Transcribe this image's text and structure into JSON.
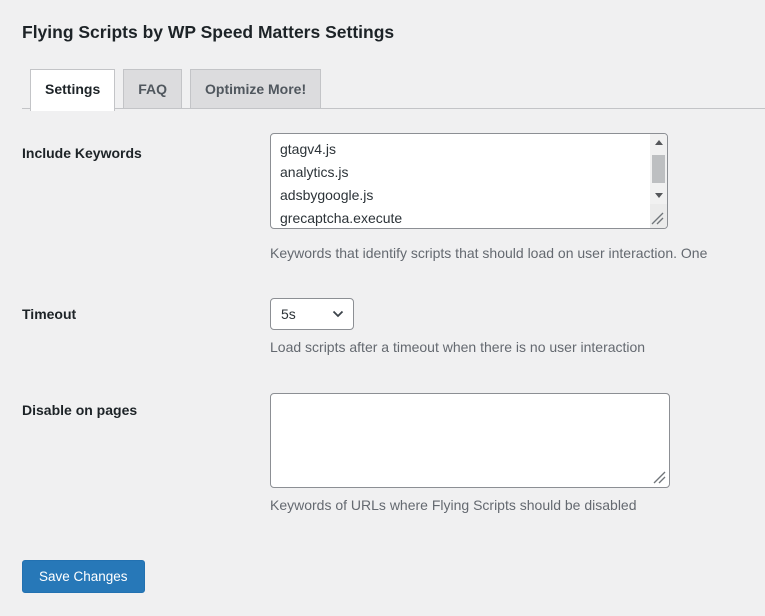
{
  "header": {
    "title": "Flying Scripts by WP Speed Matters Settings"
  },
  "tabs": {
    "items": [
      {
        "label": "Settings",
        "active": true
      },
      {
        "label": "FAQ",
        "active": false
      },
      {
        "label": "Optimize More!",
        "active": false
      }
    ]
  },
  "form": {
    "include_keywords": {
      "label": "Include Keywords",
      "lines": [
        "gtagv4.js",
        "analytics.js",
        "adsbygoogle.js",
        "grecaptcha.execute"
      ],
      "value": "gtagv4.js\nanalytics.js\nadsbygoogle.js\ngrecaptcha.execute",
      "help": "Keywords that identify scripts that should load on user interaction. One"
    },
    "timeout": {
      "label": "Timeout",
      "value": "5s",
      "help": "Load scripts after a timeout when there is no user interaction"
    },
    "disable_on_pages": {
      "label": "Disable on pages",
      "value": "",
      "help": "Keywords of URLs where Flying Scripts should be disabled"
    }
  },
  "actions": {
    "save_label": "Save Changes"
  },
  "colors": {
    "page_background": "#f0f0f1",
    "active_tab_background": "#ffffff",
    "inactive_tab_background": "#dcdcde",
    "tab_border": "#c3c4c7",
    "input_border": "#8c8f94",
    "heading_text": "#1d2327",
    "help_text": "#646970",
    "button_blue": "#2778b8"
  }
}
